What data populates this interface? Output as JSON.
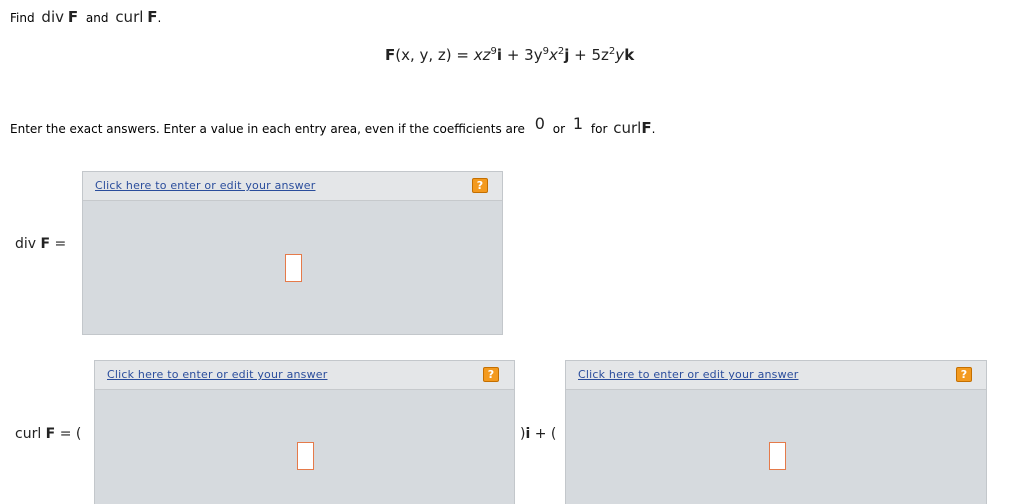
{
  "question": {
    "find_word": "Find",
    "div_word": "div",
    "F": "F",
    "and_word": "and",
    "curl_word": "curl",
    "period": "."
  },
  "formula": {
    "lhs_F": "F",
    "lhs_args": "(x, y, z) = ",
    "t1": "xz",
    "t1_exp": "9",
    "i": "i",
    "plus1": " + 3y",
    "t2_exp1": "9",
    "t2_x": "x",
    "t2_exp2": "2",
    "j": "j",
    "plus2": " + 5z",
    "t3_exp": "2",
    "t3_y": "y",
    "k": "k"
  },
  "instruction": {
    "text": "Enter the exact answers. Enter a value in each entry area, even if the coefficients are",
    "zero": "0",
    "or_word": "or",
    "one": "1",
    "for_word": "for",
    "curl_word": "curl",
    "F": "F",
    "period": "."
  },
  "div_row": {
    "label_div": "div",
    "label_F": "F",
    "equals": "="
  },
  "curl_row": {
    "label_curl": "curl",
    "label_F": "F",
    "equals_paren": "= (",
    "mid_paren": ")",
    "i": "i",
    "plus_paren": " + ("
  },
  "answer_panels": {
    "link_label": "Click here to enter or edit your answer",
    "help_label": "?"
  },
  "colors": {
    "panel_bg": "#d6dade",
    "link": "#2a4d9c",
    "help_button": "#f39a1f",
    "entry_border": "#e57a4a"
  }
}
